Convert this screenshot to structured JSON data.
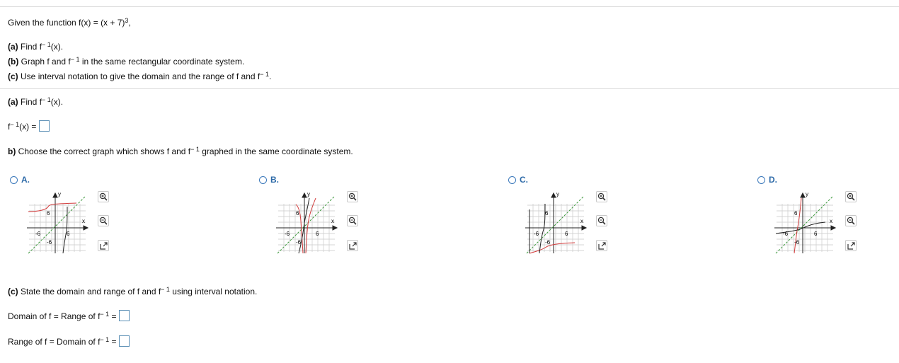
{
  "problem": {
    "given_prefix": "Given the function f(x) = (x + 7)",
    "given_exp": "3",
    "given_suffix": ",",
    "part_a_label": "(a)",
    "part_a_text": "Find f",
    "part_a_sup": "− 1",
    "part_a_after": "(x).",
    "part_b_label": "(b)",
    "part_b_text": "Graph f and f",
    "part_b_sup": "− 1",
    "part_b_after": "in the same rectangular coordinate system.",
    "part_c_label": "(c)",
    "part_c_text": "Use interval notation to give the domain and the range of f and f",
    "part_c_sup": "− 1",
    "part_c_after": "."
  },
  "section_a": {
    "label": "(a)",
    "text": "Find f",
    "sup": "− 1",
    "after": "(x).",
    "answer_prefix": "f",
    "answer_sup": "− 1",
    "answer_suffix": "(x) ="
  },
  "section_b": {
    "label": "b)",
    "text": "Choose the correct graph which shows f and f",
    "sup": "− 1",
    "after": "graphed in the same coordinate system.",
    "options": [
      {
        "label": "A."
      },
      {
        "label": "B."
      },
      {
        "label": "C."
      },
      {
        "label": "D."
      }
    ],
    "graph_labels": {
      "y": "y",
      "x": "x",
      "pos": "6",
      "neg": "-6"
    },
    "icons": {
      "zoom_in": "zoom-in-icon",
      "zoom_out": "zoom-out-icon",
      "popout": "popout-icon"
    },
    "colors": {
      "f_curve": "#d23a3a",
      "inverse_curve": "#222222",
      "identity_line": "#3f9a3f",
      "grid": "#c9c9c9",
      "radio": "#3a78bb",
      "accent": "#2d6aa8"
    }
  },
  "section_c": {
    "label": "(c)",
    "text": "State the domain and range of f and f",
    "sup": "− 1",
    "after": "using interval notation.",
    "domain_text": "Domain of f = Range of f",
    "domain_sup": "− 1",
    "domain_eq": "=",
    "range_text": "Range of f = Domain of f",
    "range_sup": "− 1",
    "range_eq": "="
  }
}
